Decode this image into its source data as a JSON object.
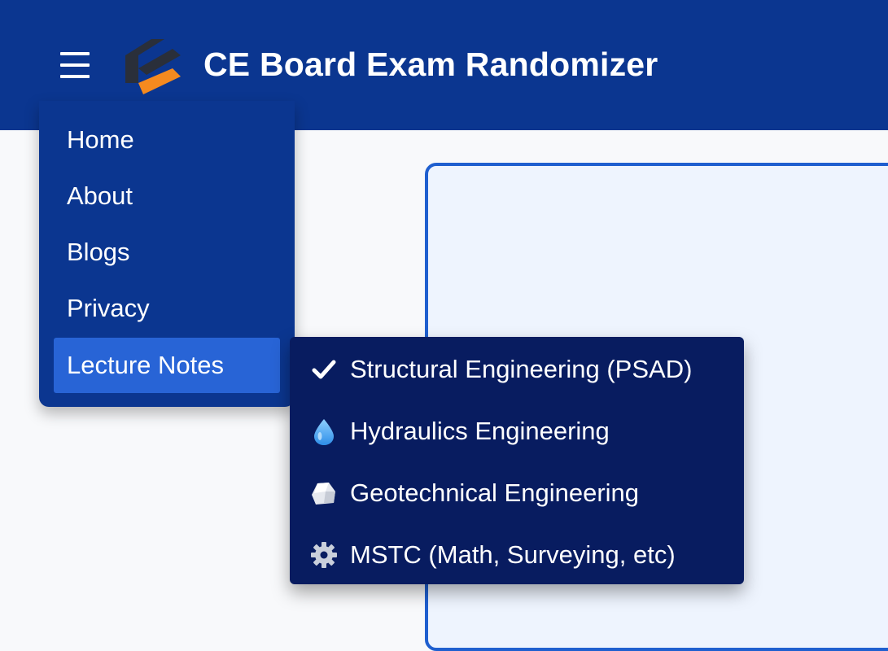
{
  "header": {
    "title": "CE Board Exam Randomizer",
    "menu_icon": "hamburger-menu-icon",
    "logo_icon": "ce-logo-icon",
    "colors": {
      "background": "#0b3690",
      "logo_dark": "#2a2f3a",
      "logo_accent": "#f58a1f"
    }
  },
  "nav": {
    "items": [
      {
        "label": "Home"
      },
      {
        "label": "About"
      },
      {
        "label": "Blogs"
      },
      {
        "label": "Privacy"
      },
      {
        "label": "Lecture Notes",
        "active": true
      }
    ],
    "active_color": "#2864d6"
  },
  "submenu": {
    "items": [
      {
        "icon": "checkmark-icon",
        "label": "Structural Engineering (PSAD)"
      },
      {
        "icon": "water-drop-icon",
        "label": "Hydraulics Engineering"
      },
      {
        "icon": "rock-icon",
        "label": "Geotechnical Engineering"
      },
      {
        "icon": "gear-icon",
        "label": "MSTC (Math, Surveying, etc)"
      }
    ],
    "background": "#081c60"
  },
  "content": {
    "card_border_color": "#1f5fcf"
  }
}
